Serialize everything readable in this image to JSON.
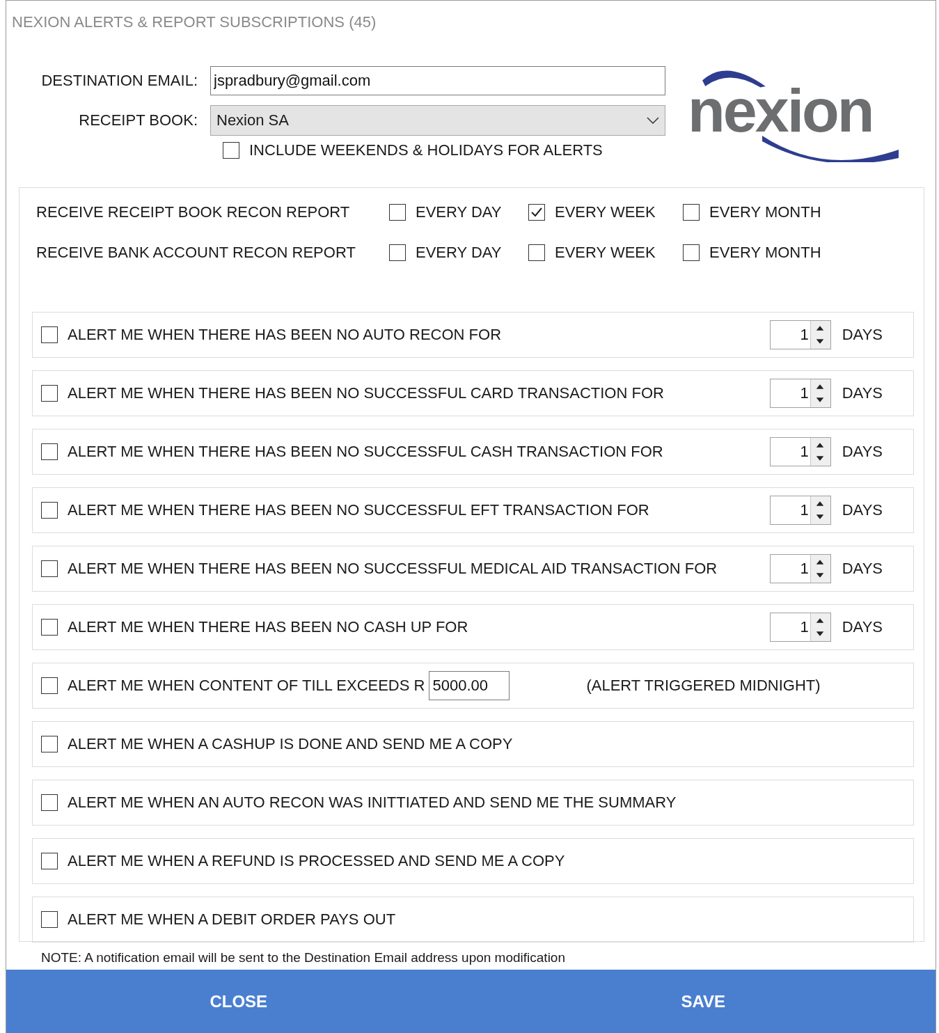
{
  "window": {
    "title": "NEXION ALERTS & REPORT SUBSCRIPTIONS (45)"
  },
  "logo": {
    "text": "nexion"
  },
  "destination_email": {
    "label": "DESTINATION EMAIL:",
    "value": "jspradbury@gmail.com"
  },
  "receipt_book": {
    "label": "RECEIPT BOOK:",
    "value": "Nexion SA"
  },
  "include_weekends": {
    "label": "INCLUDE WEEKENDS & HOLIDAYS FOR ALERTS",
    "checked": false
  },
  "reports": [
    {
      "label": "RECEIVE RECEIPT BOOK RECON REPORT",
      "options": [
        {
          "label": "EVERY DAY",
          "checked": false
        },
        {
          "label": "EVERY WEEK",
          "checked": true
        },
        {
          "label": "EVERY MONTH",
          "checked": false
        }
      ]
    },
    {
      "label": "RECEIVE BANK ACCOUNT RECON REPORT",
      "options": [
        {
          "label": "EVERY DAY",
          "checked": false
        },
        {
          "label": "EVERY WEEK",
          "checked": false
        },
        {
          "label": "EVERY MONTH",
          "checked": false
        }
      ]
    }
  ],
  "alerts": [
    {
      "kind": "days",
      "label": "ALERT ME WHEN THERE HAS BEEN NO AUTO RECON FOR",
      "checked": false,
      "value": "1",
      "unit": "DAYS"
    },
    {
      "kind": "days",
      "label": "ALERT ME WHEN THERE HAS BEEN NO SUCCESSFUL CARD TRANSACTION FOR",
      "checked": false,
      "value": "1",
      "unit": "DAYS"
    },
    {
      "kind": "days",
      "label": "ALERT ME WHEN THERE HAS BEEN NO SUCCESSFUL CASH TRANSACTION FOR",
      "checked": false,
      "value": "1",
      "unit": "DAYS"
    },
    {
      "kind": "days",
      "label": "ALERT ME WHEN THERE HAS BEEN NO SUCCESSFUL EFT TRANSACTION FOR",
      "checked": false,
      "value": "1",
      "unit": "DAYS"
    },
    {
      "kind": "days",
      "label": "ALERT ME WHEN THERE HAS BEEN NO SUCCESSFUL MEDICAL AID TRANSACTION FOR",
      "checked": false,
      "value": "1",
      "unit": "DAYS"
    },
    {
      "kind": "days",
      "label": "ALERT ME WHEN THERE HAS BEEN NO CASH UP FOR",
      "checked": false,
      "value": "1",
      "unit": "DAYS"
    },
    {
      "kind": "amount",
      "label": "ALERT ME WHEN CONTENT OF TILL EXCEEDS R",
      "checked": false,
      "value": "5000.00",
      "note": "(ALERT TRIGGERED MIDNIGHT)"
    },
    {
      "kind": "plain",
      "label": "ALERT ME WHEN A CASHUP IS DONE AND SEND ME A COPY",
      "checked": false
    },
    {
      "kind": "plain",
      "label": "ALERT ME WHEN AN AUTO RECON WAS INITTIATED AND SEND ME THE SUMMARY",
      "checked": false
    },
    {
      "kind": "plain",
      "label": "ALERT ME WHEN A REFUND IS PROCESSED AND SEND ME A COPY",
      "checked": false
    },
    {
      "kind": "plain",
      "label": "ALERT ME WHEN A DEBIT ORDER PAYS OUT",
      "checked": false
    }
  ],
  "note": "NOTE: A notification email will be sent to the Destination Email address upon modification",
  "buttons": [
    "CLOSE",
    "SAVE"
  ]
}
